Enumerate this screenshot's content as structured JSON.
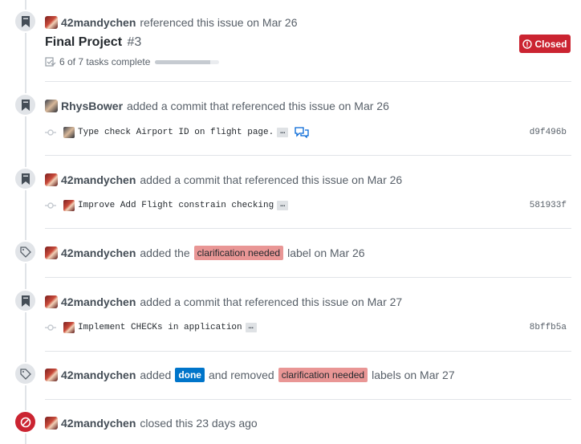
{
  "events": [
    {
      "author": "42mandychen",
      "text": "referenced this issue on Mar 26",
      "issue": {
        "title": "Final Project",
        "number": "#3",
        "state": "Closed",
        "tasks": "6 of 7 tasks complete",
        "progress": 0.86
      }
    },
    {
      "author": "RhysBower",
      "text": "added a commit that referenced this issue on Mar 26",
      "commit": {
        "message": "Type check Airport ID on flight page.",
        "ellipsis": "…",
        "sha": "d9f496b"
      }
    },
    {
      "author": "42mandychen",
      "text": "added a commit that referenced this issue on Mar 26",
      "commit": {
        "message": "Improve Add Flight constrain checking",
        "ellipsis": "…",
        "sha": "581933f"
      }
    },
    {
      "author": "42mandychen",
      "text_before": "added the",
      "label": "clarification needed",
      "text_after": "label on Mar 26"
    },
    {
      "author": "42mandychen",
      "text": "added a commit that referenced this issue on Mar 27",
      "commit": {
        "message": "Implement CHECKs in application",
        "ellipsis": "…",
        "sha": "8bffb5a"
      }
    },
    {
      "author": "42mandychen",
      "text_before": "added",
      "label_added": "done",
      "text_middle": "and removed",
      "label_removed": "clarification needed",
      "text_after": "labels on Mar 27"
    },
    {
      "author": "42mandychen",
      "text": "closed this 23 days ago"
    }
  ],
  "colors": {
    "closed": "#cb2431",
    "label_clarification": "#e99695",
    "label_done": "#0075ca",
    "timeline": "#e1e4e8"
  },
  "icons": {
    "reference": "bookmark-icon",
    "label": "tag-icon",
    "closed": "circle-slash-icon",
    "commit": "git-commit-icon",
    "comment": "comment-discussion-icon",
    "tasks": "checklist-icon",
    "state": "issue-closed-icon"
  }
}
